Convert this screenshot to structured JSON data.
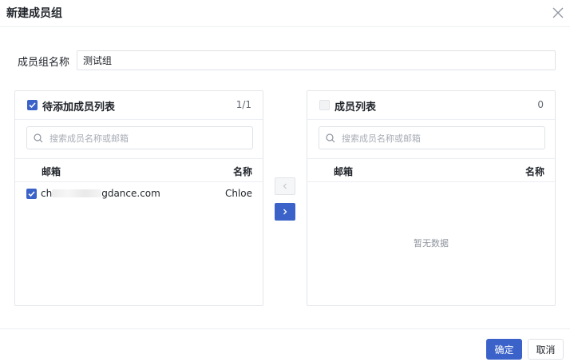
{
  "dialog": {
    "title": "新建成员组",
    "close_icon": "close-icon"
  },
  "form": {
    "label": "成员组名称",
    "value": "测试组"
  },
  "left_panel": {
    "title": "待添加成员列表",
    "count": "1/1",
    "select_all_checked": true,
    "search_placeholder": "搜索成员名称或邮箱",
    "columns": [
      "邮箱",
      "名称"
    ],
    "rows": [
      {
        "email_prefix": "ch",
        "email_suffix": "gdance.com",
        "name": "Chloe",
        "checked": true
      }
    ]
  },
  "right_panel": {
    "title": "成员列表",
    "count": "0",
    "select_all_checked": false,
    "search_placeholder": "搜索成员名称或邮箱",
    "columns": [
      "邮箱",
      "名称"
    ],
    "empty_text": "暂无数据"
  },
  "transfer": {
    "prev_icon": "chevron-left-icon",
    "next_icon": "chevron-right-icon"
  },
  "footer": {
    "confirm_label": "确定",
    "cancel_label": "取消"
  },
  "colors": {
    "accent": "#3a62c9",
    "border": "#e4e6ea",
    "muted_text": "#8f959e"
  }
}
